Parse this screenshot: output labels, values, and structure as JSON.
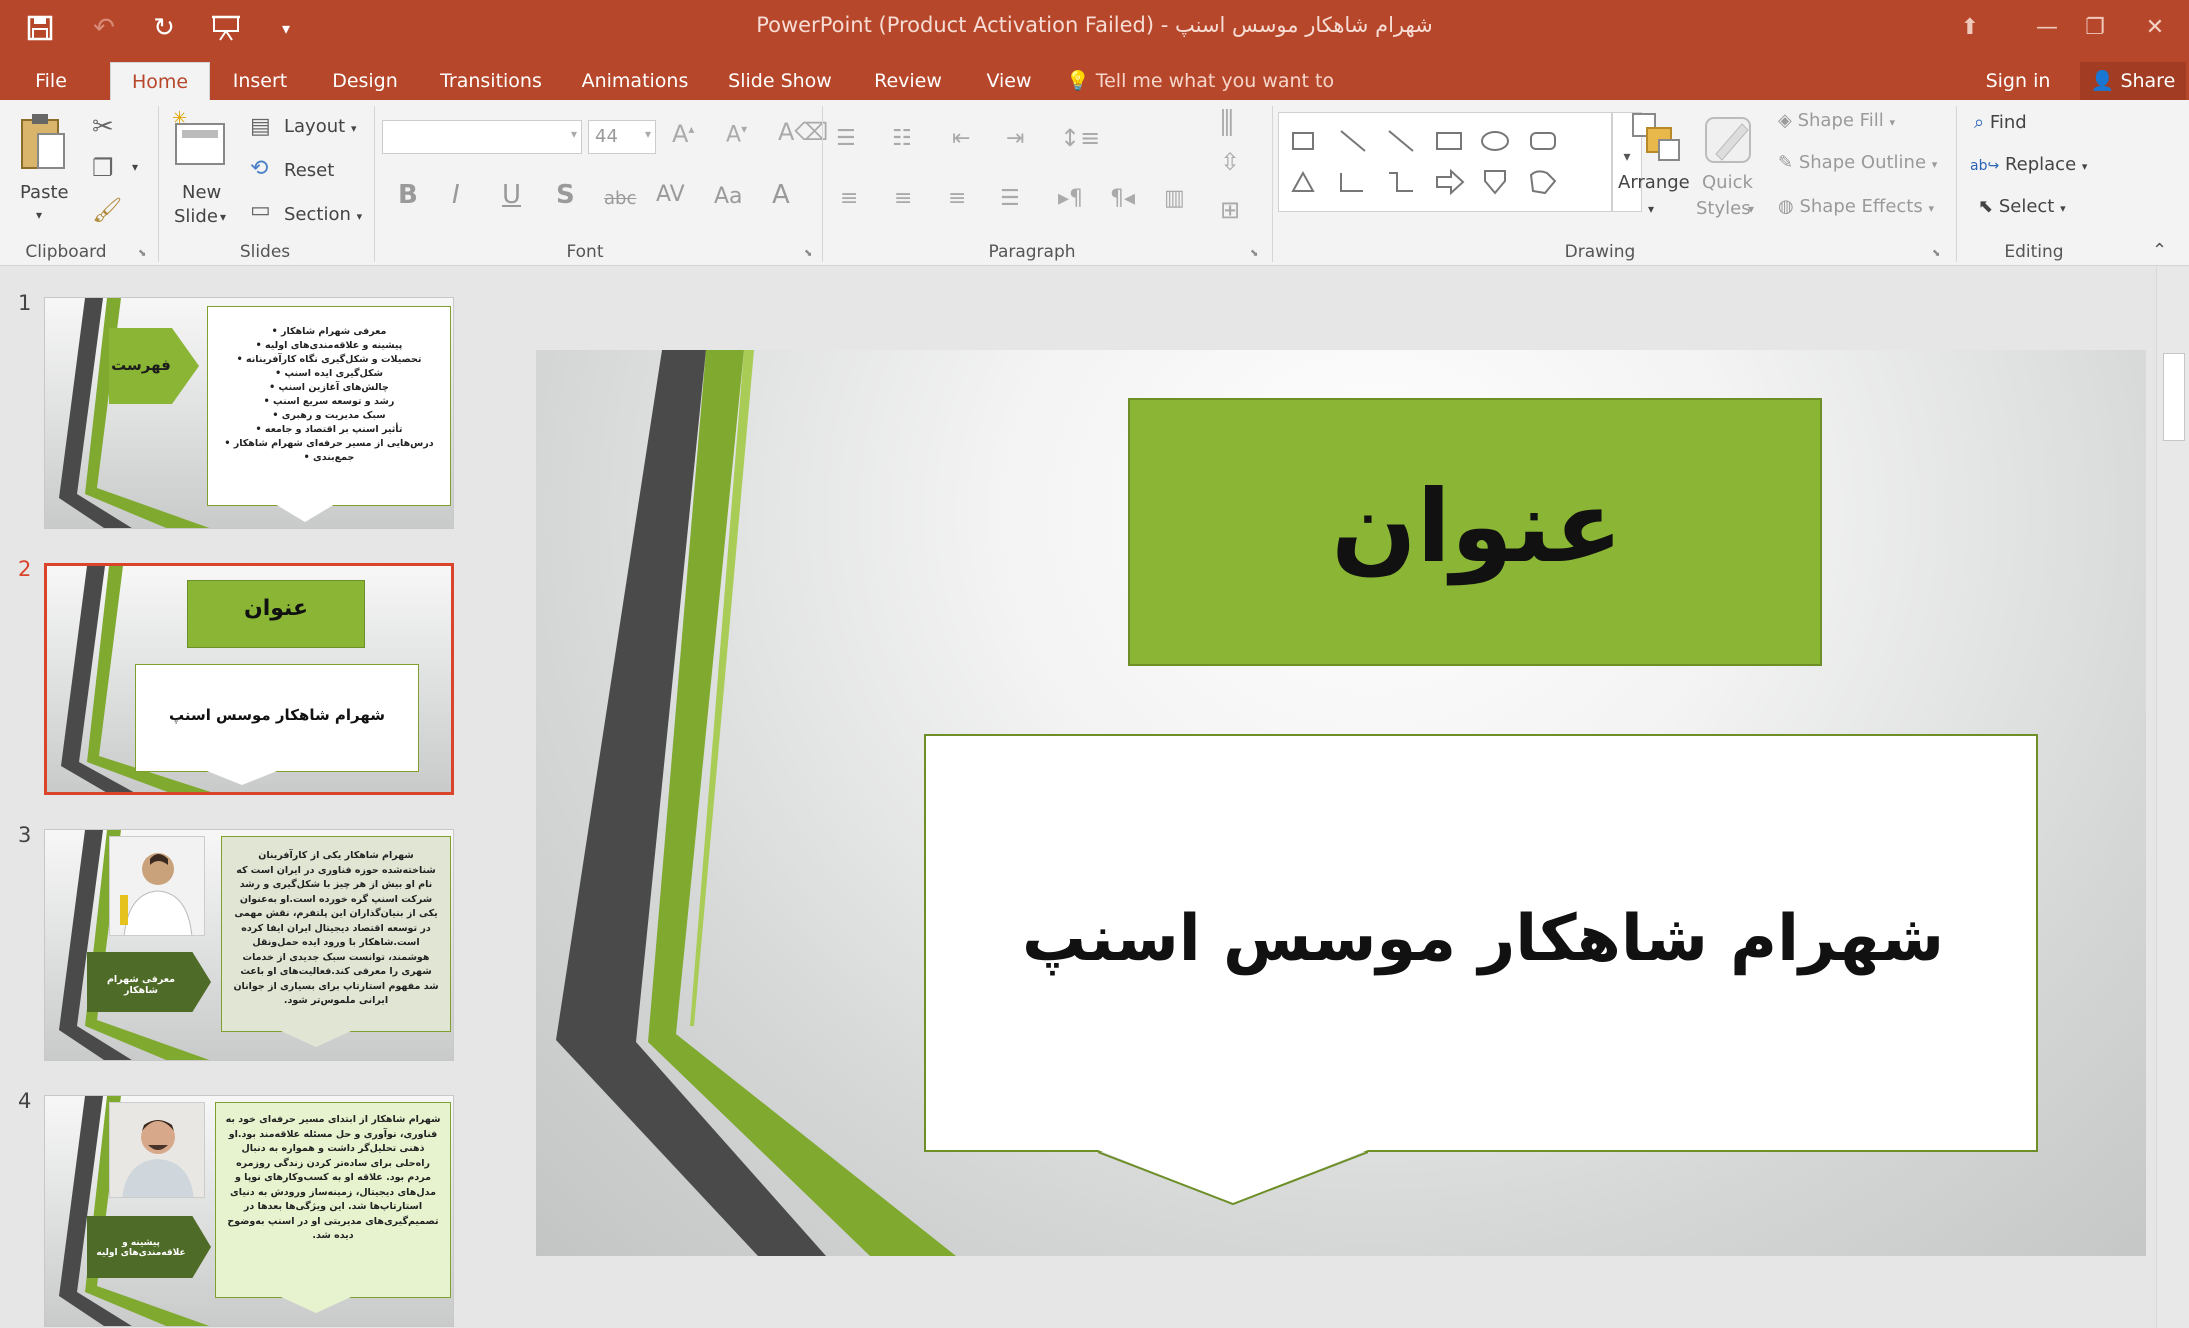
{
  "window": {
    "title": "شهرام شاهکار موسس اسنپ - PowerPoint (Product Activation Failed)"
  },
  "qat": {
    "save_icon": "save-icon",
    "undo_icon": "undo-icon",
    "redo_icon": "redo-icon",
    "present_icon": "present-from-start-icon",
    "customize_icon": "customize-qat-icon"
  },
  "tabs": [
    "File",
    "Home",
    "Insert",
    "Design",
    "Transitions",
    "Animations",
    "Slide Show",
    "Review",
    "View"
  ],
  "tellme": "Tell me what you want to do...",
  "signin": "Sign in",
  "share": "Share",
  "ribbon": {
    "clipboard": {
      "paste": "Paste",
      "label": "Clipboard"
    },
    "slides": {
      "new_slide_1": "New",
      "new_slide_2": "Slide",
      "layout": "Layout",
      "reset": "Reset",
      "section": "Section",
      "label": "Slides"
    },
    "font": {
      "font_name": "",
      "font_size": "44",
      "label": "Font",
      "bold": "B",
      "italic": "I",
      "underline": "U",
      "shadow": "S",
      "strike": "abc",
      "spacing": "AV",
      "case": "Aa",
      "color": "A"
    },
    "paragraph": {
      "label": "Paragraph"
    },
    "drawing": {
      "arrange": "Arrange",
      "quick_styles_1": "Quick",
      "quick_styles_2": "Styles",
      "shape_fill": "Shape Fill",
      "shape_outline": "Shape Outline",
      "shape_effects": "Shape Effects",
      "label": "Drawing"
    },
    "editing": {
      "find": "Find",
      "replace": "Replace",
      "select": "Select",
      "label": "Editing"
    }
  },
  "thumbnails": [
    {
      "num": "1",
      "title": "فهرست",
      "items": [
        "معرفی شهرام شاهکار",
        "پیشینه و علاقه‌مندی‌های اولیه",
        "تحصیلات و شکل‌گیری نگاه کارآفرینانه",
        "شکل‌گیری ایده اسنپ",
        "چالش‌های آغازین اسنپ",
        "رشد و توسعه سریع اسنپ",
        "سبک مدیریت و رهبری",
        "تأثیر اسنپ بر اقتصاد و جامعه",
        "درس‌هایی از مسیر حرفه‌ای شهرام شاهکار",
        "جمع‌بندی"
      ]
    },
    {
      "num": "2",
      "title": "عنوان",
      "subtitle": "شهرام شاهکار موسس اسنپ"
    },
    {
      "num": "3",
      "tag": "معرفی شهرام شاهکار",
      "body": "شهرام شاهکار یکی از کارآفرینان شناخته‌شده حوزه فناوری در ایران است که نام او بیش از هر چیز با شکل‌گیری و رشد شرکت اسنپ گره خورده است.او به‌عنوان یکی از بنیان‌گذاران این پلتفرم، نقش مهمی در توسعه اقتصاد دیجیتال ایران ایفا کرده است.شاهکار با ورود ایده حمل‌ونقل هوشمند، توانست سبک جدیدی از خدمات شهری را معرفی کند.فعالیت‌های او باعث شد مفهوم استارتاپ برای بسیاری از جوانان ایرانی ملموس‌تر شود."
    },
    {
      "num": "4",
      "tag": "پیشینه و علاقه‌مندی‌های اولیه",
      "body": "شهرام شاهکار از ابتدای مسیر حرفه‌ای خود به فناوری، نوآوری و حل مسئله علاقه‌مند بود.او ذهنی تحلیل‌گر داشت و همواره به دنبال راه‌حلی برای ساده‌تر کردن زندگی روزمره مردم بود. علاقه او به کسب‌وکارهای نوپا و مدل‌های دیجیتال، زمینه‌ساز ورودش به دنیای استارتاپ‌ها شد. این ویژگی‌ها بعدها در تصمیم‌گیری‌های مدیریتی او در اسنپ به‌وضوح دیده شد."
    }
  ],
  "slide": {
    "title": "عنوان",
    "subtitle": "شهرام شاهکار موسس اسنپ"
  },
  "colors": {
    "accent": "#b7472a",
    "green": "#8ab535",
    "dark_green": "#4f6b28",
    "stripe_gray": "#4a4a4a"
  }
}
